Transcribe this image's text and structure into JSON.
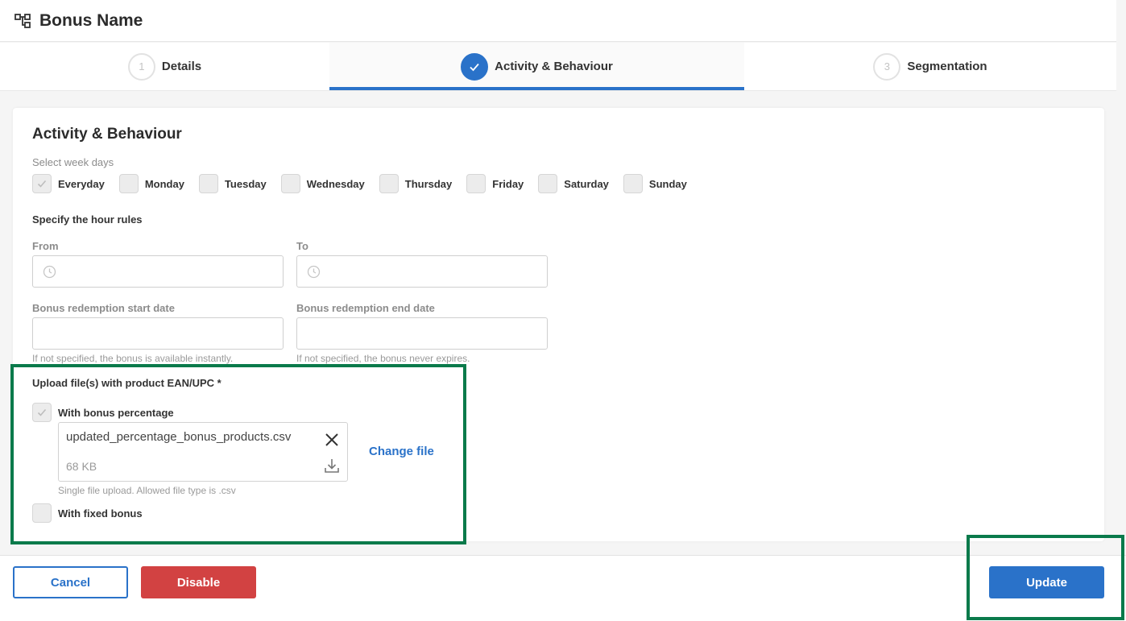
{
  "header": {
    "title": "Bonus Name",
    "icon": "sitemap-icon"
  },
  "stepper": {
    "steps": [
      {
        "number": "1",
        "label": "Details"
      },
      {
        "number": "",
        "label": "Activity & Behaviour"
      },
      {
        "number": "3",
        "label": "Segmentation"
      }
    ]
  },
  "section": {
    "title": "Activity & Behaviour",
    "weekdays_label": "Select week days",
    "weekdays": [
      "Everyday",
      "Monday",
      "Tuesday",
      "Wednesday",
      "Thursday",
      "Friday",
      "Saturday",
      "Sunday"
    ],
    "hour_rules_label": "Specify the hour rules",
    "from_label": "From",
    "to_label": "To",
    "start_date_label": "Bonus redemption start date",
    "end_date_label": "Bonus redemption end date",
    "start_date_hint": "If not specified, the bonus is available instantly.",
    "end_date_hint": "If not specified, the bonus never expires."
  },
  "upload": {
    "title": "Upload file(s) with product EAN/UPC *",
    "percentage_label": "With bonus percentage",
    "file_name": "updated_percentage_bonus_products.csv",
    "file_size": "68 KB",
    "change_file": "Change file",
    "hint": "Single file upload. Allowed file type is .csv",
    "fixed_label": "With fixed bonus"
  },
  "footer": {
    "cancel": "Cancel",
    "disable": "Disable",
    "update": "Update"
  },
  "colors": {
    "primary": "#2a72c9",
    "danger": "#d24242",
    "highlight": "#0a7a4b"
  }
}
